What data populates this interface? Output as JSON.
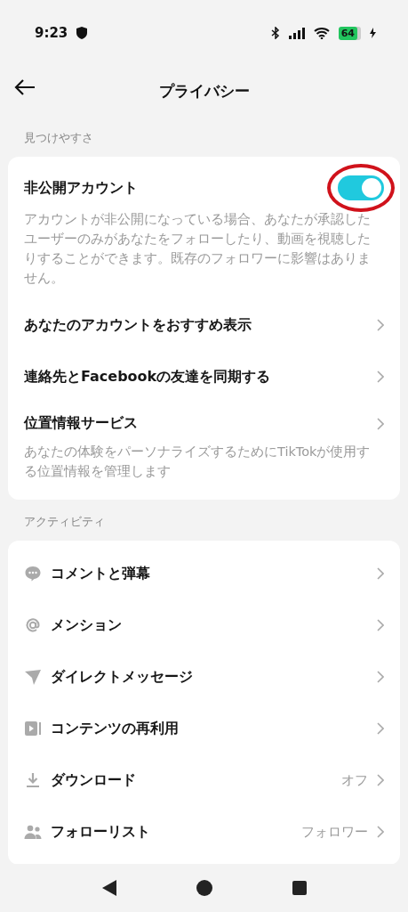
{
  "status_bar": {
    "time": "9:23",
    "battery": "64"
  },
  "header": {
    "title": "プライバシー"
  },
  "sections": [
    {
      "label": "見つけやすさ",
      "items": [
        {
          "kind": "toggle",
          "title": "非公開アカウント",
          "on": true,
          "annotated": true,
          "description": "アカウントが非公開になっている場合、あなたが承認したユーザーのみがあなたをフォローしたり、動画を視聴したりすることができます。既存のフォロワーに影響はありません。"
        },
        {
          "kind": "link",
          "title": "あなたのアカウントをおすすめ表示"
        },
        {
          "kind": "link",
          "title": "連絡先とFacebookの友達を同期する"
        },
        {
          "kind": "link",
          "title": "位置情報サービス",
          "description": "あなたの体験をパーソナライズするためにTikTokが使用する位置情報を管理します"
        }
      ]
    },
    {
      "label": "アクティビティ",
      "items": [
        {
          "kind": "icon_link",
          "title": "コメントと弾幕"
        },
        {
          "kind": "icon_link",
          "title": "メンション"
        },
        {
          "kind": "icon_link",
          "title": "ダイレクトメッセージ"
        },
        {
          "kind": "icon_link",
          "title": "コンテンツの再利用"
        },
        {
          "kind": "icon_link",
          "title": "ダウンロード",
          "value": "オフ"
        },
        {
          "kind": "icon_link",
          "title": "フォローリスト",
          "value": "フォロワー"
        }
      ]
    }
  ]
}
